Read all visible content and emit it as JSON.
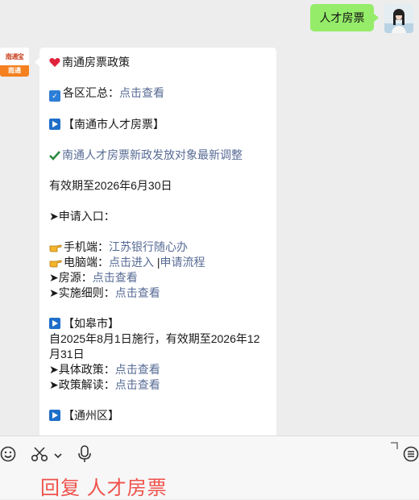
{
  "user_message": {
    "text": "人才房票"
  },
  "bot_avatar": {
    "line1": "南通宝",
    "line2": "南通"
  },
  "bot_message": {
    "title": "南通房票政策",
    "summary_label": "各区汇总：",
    "summary_link": "点击查看",
    "section_city": "【南通市人才房票】",
    "news_link": "南通人才房票新政发放对象最新调整",
    "validity": "有效期至2026年6月30日",
    "apply_label": "➤申请入口：",
    "mobile_label": "手机端：",
    "mobile_link": "江苏银行随心办",
    "pc_label": "电脑端：",
    "pc_link1": "点击进入",
    "pc_sep": " |",
    "pc_link2": "申请流程",
    "house_label": "➤房源：",
    "house_link": "点击查看",
    "rules_label": "➤实施细则：",
    "rules_link": "点击查看",
    "section_rugao": "【如皋市】",
    "rugao_line1": "自2025年8月1日施行，有效期至2026年12",
    "rugao_line2": "月31日",
    "policy_label": "➤具体政策：",
    "policy_link": "点击查看",
    "interpret_label": "➤政策解读：",
    "interpret_link": "点击查看",
    "section_tongzhou": "【通州区】"
  },
  "input_bar": {
    "reply_text": "回复 人才房票"
  },
  "icons": [
    "emoji-icon",
    "scissors-icon",
    "chevron-down-icon",
    "microphone-icon",
    "expand-icon",
    "menu-icon"
  ],
  "colors": {
    "link": "#576b95",
    "user_bubble": "#95ec69",
    "reply": "#f0514b"
  }
}
